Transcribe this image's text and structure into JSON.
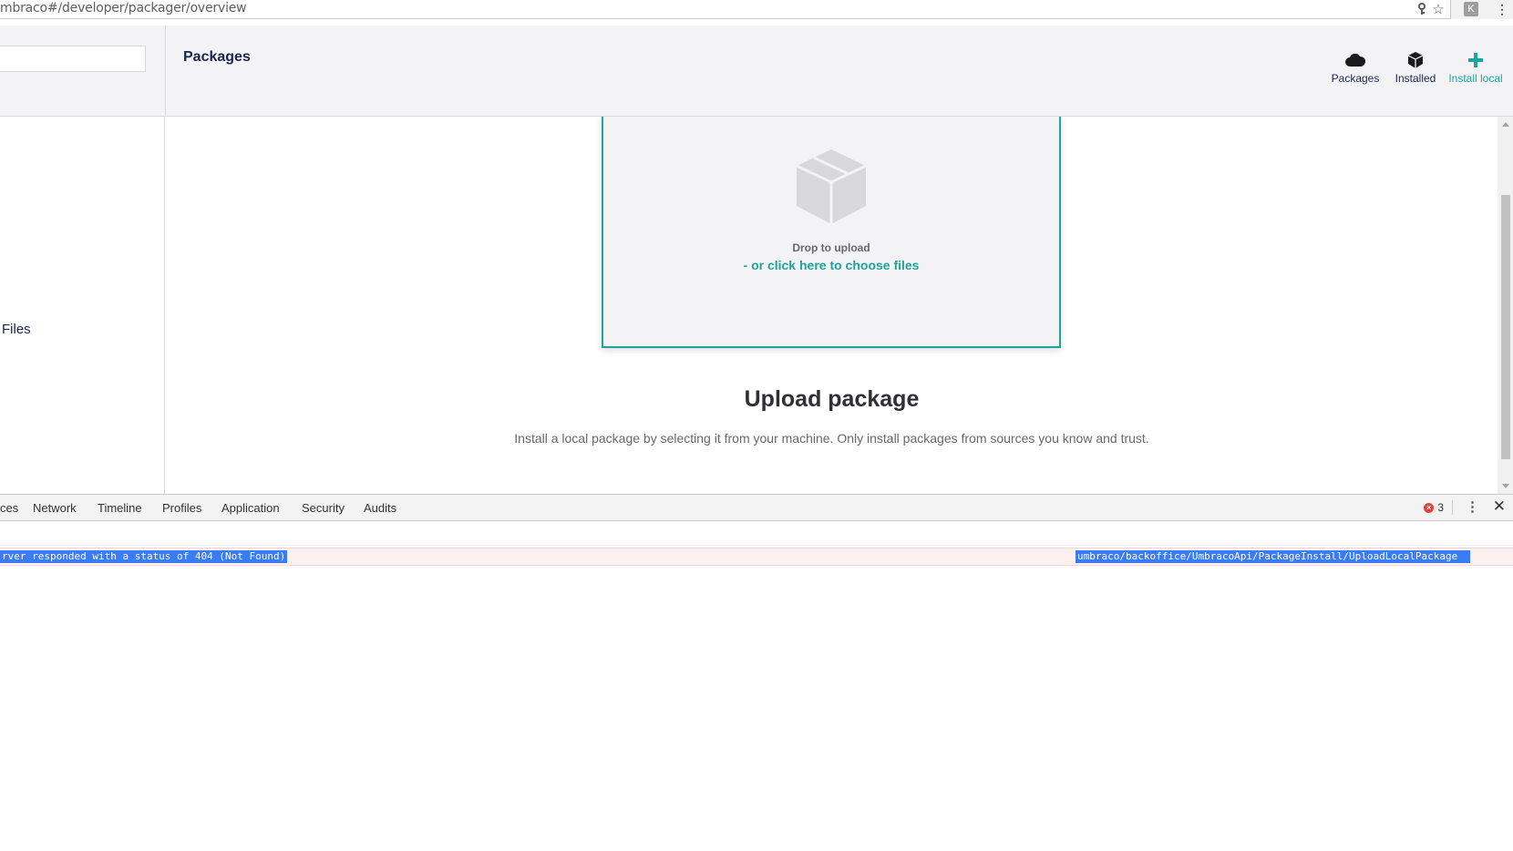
{
  "browser": {
    "url": "mbraco#/developer/packager/overview",
    "icons": [
      "key-icon",
      "star-icon",
      "extension-icon",
      "menu-icon"
    ],
    "extension_badge": "K"
  },
  "header": {
    "title": "Packages",
    "sub_views": [
      {
        "label": "Packages",
        "icon": "cloud-icon",
        "active": false
      },
      {
        "label": "Installed",
        "icon": "box-icon",
        "active": false
      },
      {
        "label": "Install local",
        "icon": "plus-icon",
        "active": true
      }
    ]
  },
  "tree": {
    "visible_item": "Files"
  },
  "upload": {
    "drop_text": "Drop to upload",
    "choose_text": "- or click here to choose files",
    "title": "Upload package",
    "description": "Install a local package by selecting it from your machine. Only install packages from sources you know and trust."
  },
  "devtools": {
    "tabs": [
      "ces",
      "Network",
      "Timeline",
      "Profiles",
      "Application",
      "Security",
      "Audits"
    ],
    "error_count": "3",
    "error_message": "rver responded with a status of 404 (Not Found)",
    "error_source": "umbraco/backoffice/UmbracoApi/PackageInstall/UploadLocalPackage"
  },
  "colors": {
    "accent": "#1fa39a",
    "header_bg": "#f3f3f5",
    "text": "#1b264f",
    "error_bg": "#fff0f0",
    "selection": "#3a7cf4"
  }
}
